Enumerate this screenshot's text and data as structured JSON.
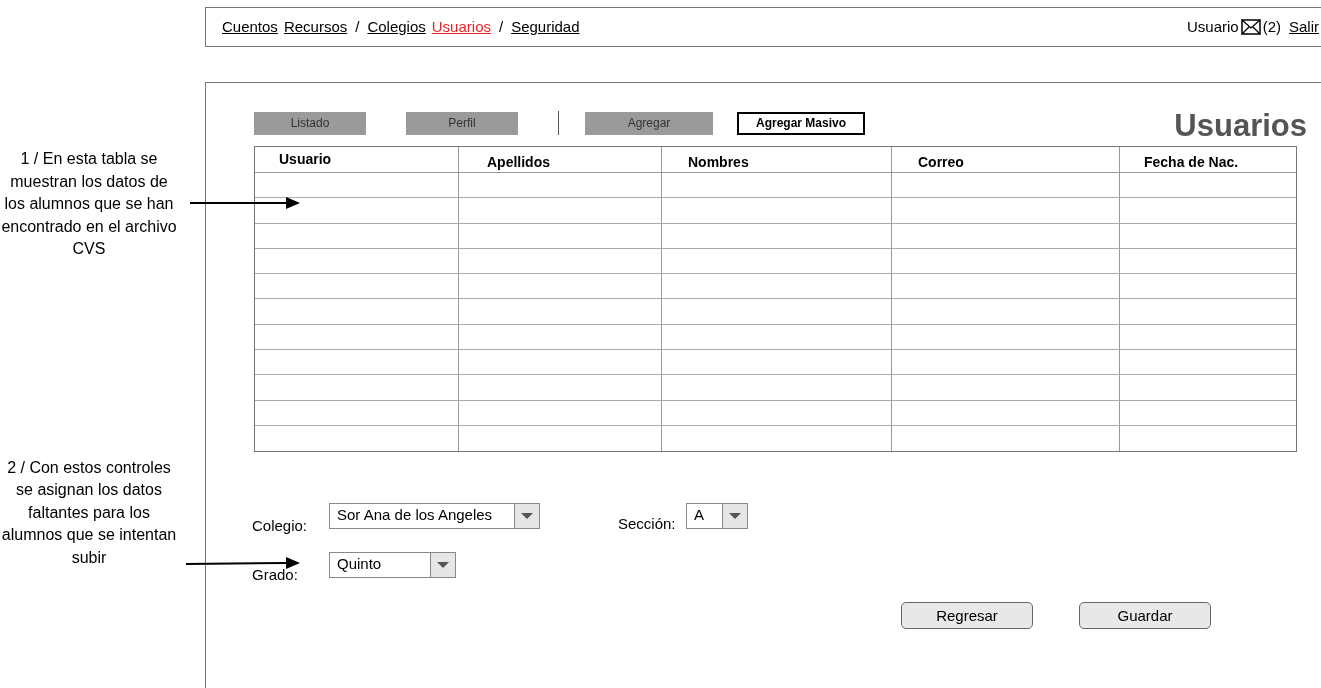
{
  "annotations": [
    {
      "text": "1 / En esta tabla se muestran los datos de los alumnos que se han encontrado en el archivo CVS"
    },
    {
      "text": "2 / Con estos controles se asignan los datos faltantes para los alumnos que se intentan subir"
    }
  ],
  "nav": {
    "items": [
      {
        "kind": "link",
        "label": "Cuentos",
        "selected": false
      },
      {
        "kind": "link",
        "label": "Recursos",
        "selected": false
      },
      {
        "kind": "separator",
        "label": "/"
      },
      {
        "kind": "link",
        "label": "Colegios",
        "selected": false
      },
      {
        "kind": "link",
        "label": "Usuarios",
        "selected": true
      },
      {
        "kind": "separator",
        "label": "/"
      },
      {
        "kind": "link",
        "label": "Seguridad",
        "selected": false
      }
    ],
    "user": "Usuario",
    "messages": "(2)",
    "logout": "Salir"
  },
  "tabs": [
    {
      "label": "Listado",
      "selected": false
    },
    {
      "label": "Perfil",
      "selected": false
    },
    {
      "label": "Agregar",
      "selected": false
    },
    {
      "label": "Agregar Masivo",
      "selected": true
    }
  ],
  "page_title": "Usuarios",
  "table": {
    "columns": [
      "Usuario",
      "Apellidos",
      "Nombres",
      "Correo",
      "Fecha de Nac."
    ]
  },
  "form": {
    "colegio": {
      "label": "Colegio:",
      "value": "Sor Ana de los Angeles"
    },
    "seccion": {
      "label": "Sección:",
      "value": "A"
    },
    "grado": {
      "label": "Grado:",
      "value": "Quinto"
    }
  },
  "buttons": [
    "Regresar",
    "Guardar"
  ]
}
